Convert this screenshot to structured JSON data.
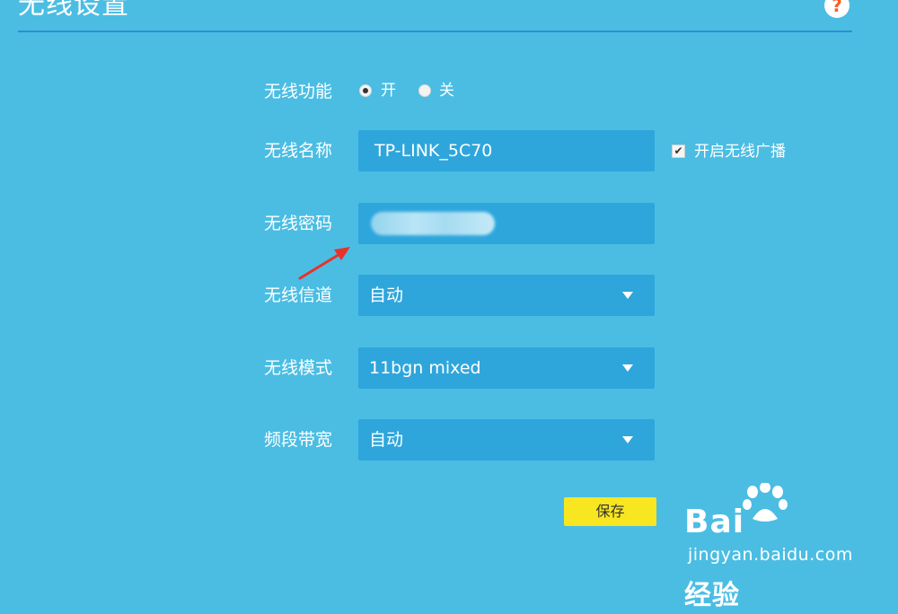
{
  "header": {
    "title": "无线设置",
    "help_icon_text": "?"
  },
  "form": {
    "wireless_function": {
      "label": "无线功能",
      "options": [
        "开",
        "关"
      ],
      "selected": "开"
    },
    "ssid": {
      "label": "无线名称",
      "value": "TP-LINK_5C70",
      "broadcast_label": "开启无线广播",
      "broadcast_checked": true
    },
    "password": {
      "label": "无线密码"
    },
    "channel": {
      "label": "无线信道",
      "value": "自动"
    },
    "mode": {
      "label": "无线模式",
      "value": "11bgn mixed"
    },
    "bandwidth": {
      "label": "频段带宽",
      "value": "自动"
    },
    "save_label": "保存"
  },
  "watermark": {
    "brand": "Bai",
    "brand_cn": "经验",
    "url": "jingyan.baidu.com"
  },
  "colors": {
    "background": "#4bbde3",
    "field": "#2ea6dc",
    "divider": "#2a8fd0",
    "save_button": "#f7e620",
    "annotation_arrow": "#e8322b"
  },
  "icons": [
    "help-icon",
    "dropdown-caret-icon",
    "checkbox-check-icon",
    "annotation-arrow-icon",
    "baidu-paw-icon"
  ]
}
